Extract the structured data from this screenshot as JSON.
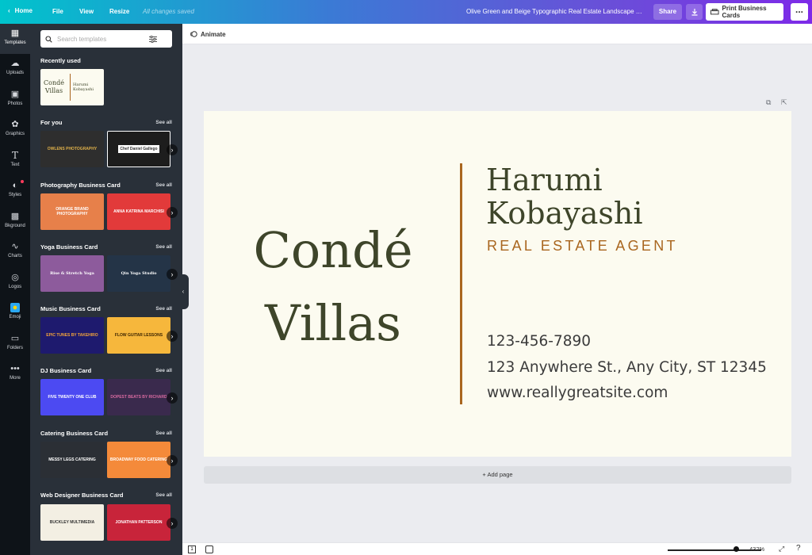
{
  "topbar": {
    "home": "Home",
    "file": "File",
    "view": "View",
    "resize": "Resize",
    "saved_status": "All changes saved",
    "doc_title": "Olive Green and Beige Typographic Real Estate Landscape S...",
    "share": "Share",
    "print": "Print Business Cards",
    "more": "..."
  },
  "rail": {
    "items": [
      {
        "label": "Templates",
        "icon": "templates-icon"
      },
      {
        "label": "Uploads",
        "icon": "uploads-icon"
      },
      {
        "label": "Photos",
        "icon": "photos-icon"
      },
      {
        "label": "Graphics",
        "icon": "graphics-icon"
      },
      {
        "label": "Text",
        "icon": "text-icon"
      },
      {
        "label": "Styles",
        "icon": "styles-icon"
      },
      {
        "label": "Bkground",
        "icon": "background-icon"
      },
      {
        "label": "Charts",
        "icon": "charts-icon"
      },
      {
        "label": "Logos",
        "icon": "logos-icon"
      },
      {
        "label": "Emoji",
        "icon": "emoji-icon"
      },
      {
        "label": "Folders",
        "icon": "folders-icon"
      },
      {
        "label": "More",
        "icon": "more-icon"
      }
    ]
  },
  "panel": {
    "search_placeholder": "Search templates",
    "recently_used_title": "Recently used",
    "recent_thumb": {
      "brand": "Condé Villas",
      "name": "Harumi Kobayashi"
    },
    "see_all": "See all",
    "sections": [
      {
        "title": "For you",
        "thumbs": [
          "OWLENS PHOTOGRAPHY",
          "Chef Daniel Gallego"
        ]
      },
      {
        "title": "Photography Business Card",
        "thumbs": [
          "ORANGE BRAND PHOTOGRAPHY",
          "ANNA KATRINA MARCHISI"
        ]
      },
      {
        "title": "Yoga Business Card",
        "thumbs": [
          "Rise & Stretch Yoga",
          "Qin Yoga Studio"
        ]
      },
      {
        "title": "Music Business Card",
        "thumbs": [
          "EPIC TUNES BY TAKEHIRO",
          "FLOW GUITAR LESSONS"
        ]
      },
      {
        "title": "DJ Business Card",
        "thumbs": [
          "FIVE TWENTY ONE CLUB",
          "DOPEST BEATS BY RICHARD"
        ]
      },
      {
        "title": "Catering Business Card",
        "thumbs": [
          "MESSY LEGS CATERING",
          "BROADWAY FOOD CATERING"
        ]
      },
      {
        "title": "Web Designer Business Card",
        "thumbs": [
          "BUCKLEY MULTIMEDIA",
          "JONATHAN PATTERSON"
        ]
      }
    ]
  },
  "editor": {
    "animate": "Animate",
    "add_page": "+ Add page",
    "zoom": "432%"
  },
  "card": {
    "brand_line1": "Condé",
    "brand_line2": "Villas",
    "name_line1": "Harumi",
    "name_line2": "Kobayashi",
    "role": "REAL ESTATE AGENT",
    "phone": "123-456-7890",
    "address": "123 Anywhere St., Any City, ST 12345",
    "website": "www.reallygreatsite.com"
  },
  "colors": {
    "olive": "#3e452a",
    "accent": "#a9661f",
    "card_bg": "#fcfbf0"
  }
}
